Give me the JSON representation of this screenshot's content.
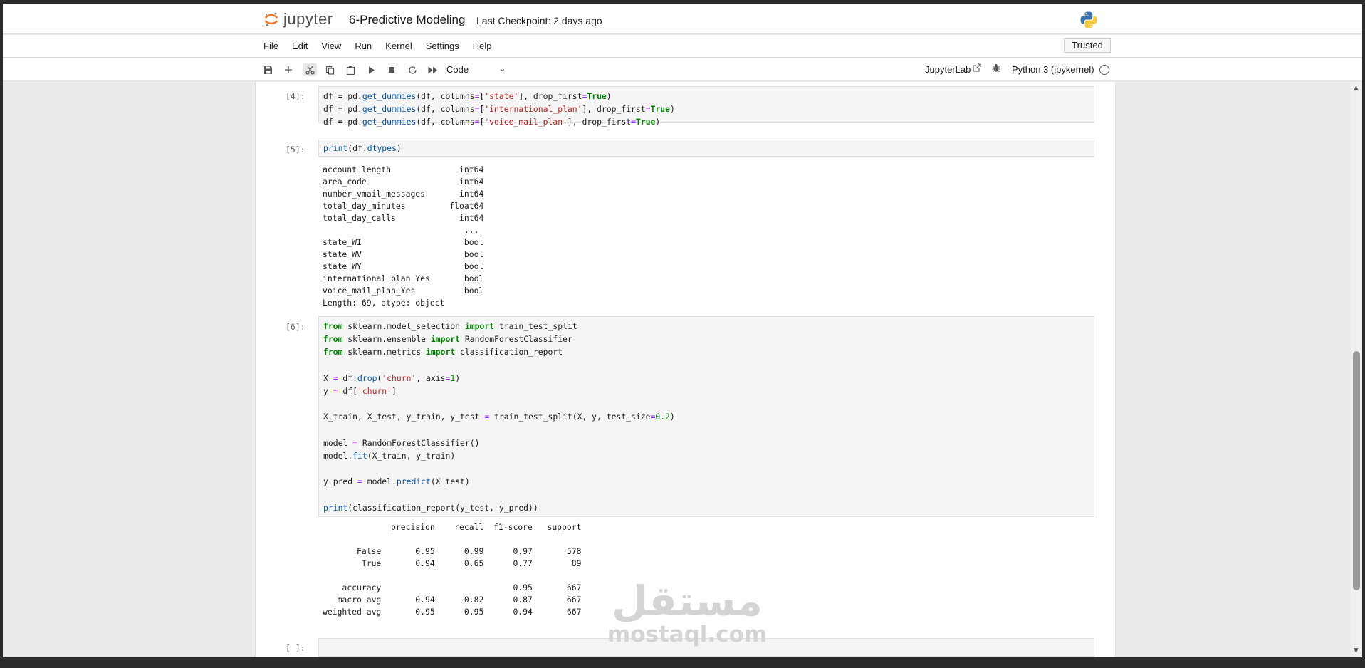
{
  "header": {
    "logo_text": "jupyter",
    "notebook_title": "6-Predictive Modeling",
    "checkpoint": "Last Checkpoint: 2 days ago"
  },
  "menu": [
    "File",
    "Edit",
    "View",
    "Run",
    "Kernel",
    "Settings",
    "Help"
  ],
  "trusted_label": "Trusted",
  "toolbar": {
    "icons": [
      "save-icon",
      "add-icon",
      "cut-icon",
      "copy-icon",
      "paste-icon",
      "run-icon",
      "stop-icon",
      "restart-icon",
      "fast-forward-icon"
    ],
    "cell_type": "Code",
    "jupyterlab_label": "JupyterLab",
    "kernel_name": "Python 3 (ipykernel)"
  },
  "cells": [
    {
      "prompt": "[4]:",
      "lines": [
        "df = pd.get_dummies(df, columns=['state'], drop_first=True)",
        "df = pd.get_dummies(df, columns=['international_plan'], drop_first=True)",
        "df = pd.get_dummies(df, columns=['voice_mail_plan'], drop_first=True)"
      ]
    },
    {
      "prompt": "[5]:",
      "lines": [
        "print(df.dtypes)"
      ],
      "output": [
        "account_length              int64",
        "area_code                   int64",
        "number_vmail_messages       int64",
        "total_day_minutes         float64",
        "total_day_calls             int64",
        "                             ...",
        "state_WI                     bool",
        "state_WV                     bool",
        "state_WY                     bool",
        "international_plan_Yes       bool",
        "voice_mail_plan_Yes          bool",
        "Length: 69, dtype: object"
      ]
    },
    {
      "prompt": "[6]:",
      "lines": [
        "from sklearn.model_selection import train_test_split",
        "from sklearn.ensemble import RandomForestClassifier",
        "from sklearn.metrics import classification_report",
        "",
        "X = df.drop('churn', axis=1)",
        "y = df['churn']",
        "",
        "X_train, X_test, y_train, y_test = train_test_split(X, y, test_size=0.2)",
        "",
        "model = RandomForestClassifier()",
        "model.fit(X_train, y_train)",
        "",
        "y_pred = model.predict(X_test)",
        "",
        "print(classification_report(y_test, y_pred))"
      ],
      "output": [
        "              precision    recall  f1-score   support",
        "",
        "       False       0.95      0.99      0.97       578",
        "        True       0.94      0.65      0.77        89",
        "",
        "    accuracy                           0.95       667",
        "   macro avg       0.94      0.82      0.87       667",
        "weighted avg       0.95      0.95      0.94       667"
      ]
    },
    {
      "prompt": "[ ]:",
      "lines": []
    }
  ],
  "watermark": {
    "arabic": "مستقل",
    "latin": "mostaql.com"
  },
  "colors": {
    "keyword": "#008000",
    "string": "#ba2121",
    "function": "#0055aa",
    "logo_orange": "#f37726"
  }
}
